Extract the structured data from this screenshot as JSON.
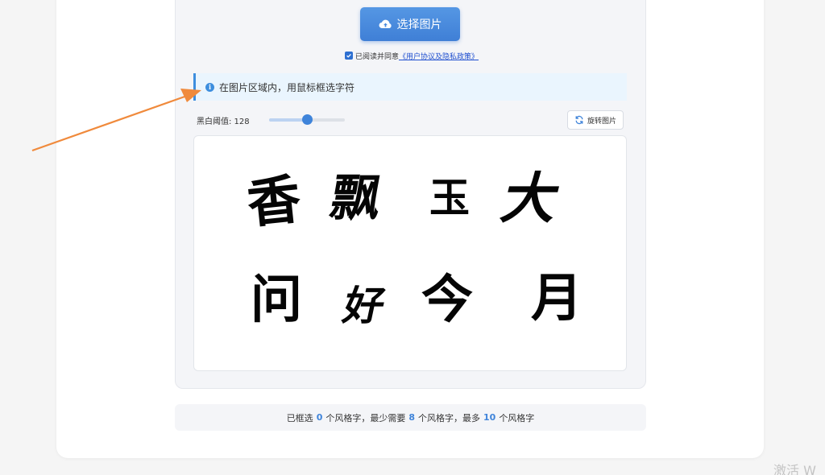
{
  "upload": {
    "button_label": "选择图片",
    "icon": "cloud-upload-icon"
  },
  "agreement": {
    "checked": true,
    "prefix": "已阅读并同意",
    "link_text": "《用户协议及隐私政策》"
  },
  "tip": {
    "icon": "info-icon",
    "text": "在图片区域内，用鼠标框选字符"
  },
  "threshold": {
    "label": "黑白阈值: 128",
    "value": 128,
    "min": 0,
    "max": 255
  },
  "rotate": {
    "label": "旋转图片",
    "icon": "rotate-icon"
  },
  "image": {
    "characters_row1": [
      "香",
      "飘",
      "玉",
      "大"
    ],
    "characters_row2": [
      "问",
      "好",
      "今",
      "月"
    ]
  },
  "status": {
    "part1": "已框选",
    "selected": "0",
    "part2": "个风格字，最少需要",
    "min_required": "8",
    "part3": "个风格字，最多",
    "max_allowed": "10",
    "part4": "个风格字"
  },
  "watermark": "激活 W",
  "colors": {
    "accent": "#3f84da",
    "arrow": "#f08a3c",
    "tip_bg": "#eaf5fe"
  }
}
